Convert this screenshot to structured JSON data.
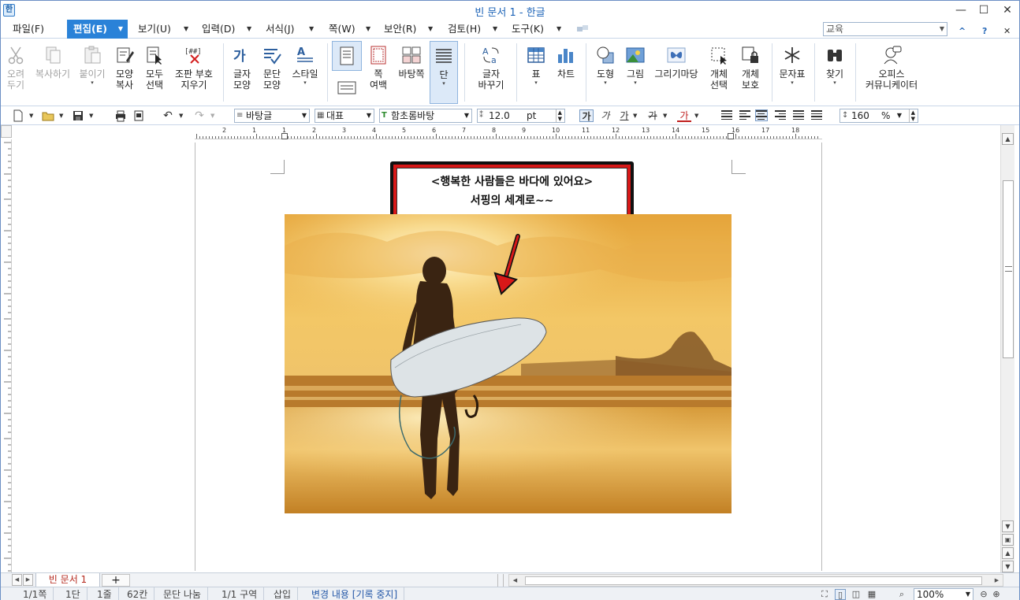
{
  "window": {
    "title": "빈 문서 1 - 한글",
    "minimize": "—",
    "maximize": "☐",
    "close": "✕"
  },
  "menu": {
    "items": [
      {
        "label": "파일(F)"
      },
      {
        "label": "편집(E)"
      },
      {
        "label": "보기(U)"
      },
      {
        "label": "입력(D)"
      },
      {
        "label": "서식(J)"
      },
      {
        "label": "쪽(W)"
      },
      {
        "label": "보안(R)"
      },
      {
        "label": "검토(H)"
      },
      {
        "label": "도구(K)"
      }
    ],
    "arrow": "▼",
    "search_value": "교육",
    "collapse": "^",
    "help": "?",
    "close": "✕"
  },
  "ribbon": {
    "cut": [
      "오려",
      "두기"
    ],
    "copy": "복사하기",
    "paste": "붙이기",
    "format_copy": [
      "모양",
      "복사"
    ],
    "select_all": [
      "모두",
      "선택"
    ],
    "erase_marks": [
      "조판 부호",
      "지우기"
    ],
    "char_shape": [
      "글자",
      "모양"
    ],
    "para_shape": [
      "문단",
      "모양"
    ],
    "style": "스타일",
    "page_margin": [
      "쪽",
      "여백"
    ],
    "background_page": "바탕쪽",
    "columns": "단",
    "replace_chars": [
      "글자",
      "바꾸기"
    ],
    "table": "표",
    "chart": "차트",
    "shape": "도형",
    "picture": "그림",
    "gallery": "그리기마당",
    "select_object": [
      "개체",
      "선택"
    ],
    "protect_object": [
      "개체",
      "보호"
    ],
    "symbols": "문자표",
    "find": "찾기",
    "office_communicator": [
      "오피스",
      "커뮤니케이터"
    ],
    "dropdown": "▾"
  },
  "toolbar": {
    "style_combo": "바탕글",
    "lang_combo": "대표",
    "font_combo": "함초롬바탕",
    "size_value": "12.0",
    "size_unit": "pt",
    "bold": "가",
    "italic": "가",
    "underline": "가",
    "strike": "가",
    "color": "가",
    "line_spacing": "160",
    "line_spacing_unit": "%"
  },
  "ruler": {
    "numbers": [
      "2",
      "1",
      "1",
      "2",
      "3",
      "4",
      "5",
      "6",
      "7",
      "8",
      "9",
      "10",
      "11",
      "12",
      "13",
      "14",
      "15",
      "16",
      "17",
      "18"
    ]
  },
  "document": {
    "callout_line1": "<행복한 사람들은 바다에 있어요>",
    "callout_line2": "서핑의 세계로~~"
  },
  "tabs": {
    "doc_tab": "빈 문서 1",
    "add": "+"
  },
  "status": {
    "page": "1/1쪽",
    "column": "1단",
    "line": "1줄",
    "char": "62칸",
    "para_break": "문단 나눔",
    "section": "1/1 구역",
    "insert_mode": "삽입",
    "track_changes": "변경 내용 [기록 중지]",
    "zoom": "100%"
  },
  "colors": {
    "accent": "#2a82d8",
    "callout_border": "#d81818",
    "title": "#1c63b7"
  }
}
